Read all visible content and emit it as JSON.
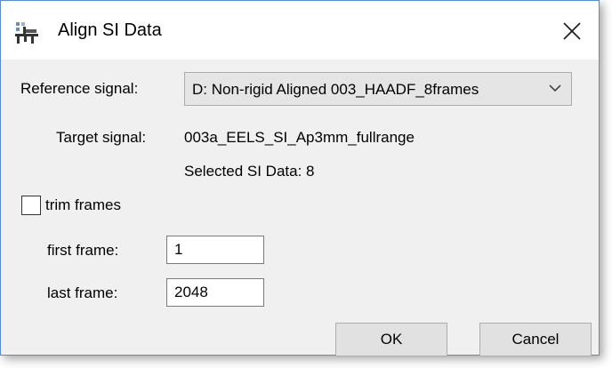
{
  "window": {
    "title": "Align SI Data",
    "close_icon": "close-icon",
    "app_icon": "app-icon"
  },
  "form": {
    "reference_label": "Reference signal:",
    "reference_value": "D: Non-rigid Aligned 003_HAADF_8frames",
    "target_label": "Target signal:",
    "target_value": "003a_EELS_SI_Ap3mm_fullrange",
    "selected_text": "Selected SI Data: 8",
    "trim_label": "trim frames",
    "trim_checked": false,
    "first_frame_label": "first frame:",
    "first_frame_value": "1",
    "last_frame_label": "last frame:",
    "last_frame_value": "2048"
  },
  "buttons": {
    "ok": "OK",
    "cancel": "Cancel"
  }
}
